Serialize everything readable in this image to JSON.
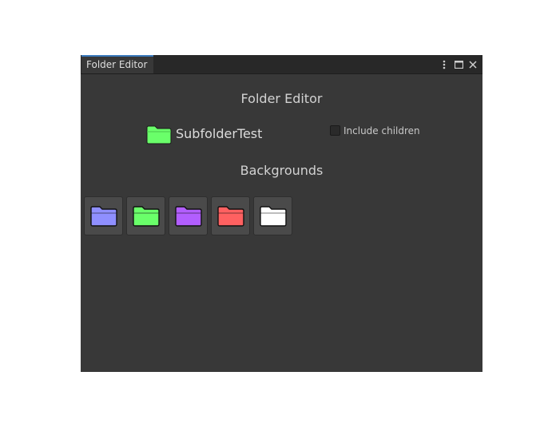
{
  "window": {
    "tab_title": "Folder Editor",
    "controls": [
      "more-options-icon",
      "maximize-icon",
      "close-icon"
    ]
  },
  "editor": {
    "title": "Folder Editor",
    "current_folder": {
      "name": "SubfolderTest",
      "color": "#6aff6a"
    },
    "include_children": {
      "label": "Include children",
      "checked": false
    },
    "backgrounds_title": "Backgrounds",
    "backgrounds": [
      {
        "name": "folder-blue-icon",
        "color": "#8f8fff"
      },
      {
        "name": "folder-green-icon",
        "color": "#6aff6a"
      },
      {
        "name": "folder-purple-icon",
        "color": "#b25eff"
      },
      {
        "name": "folder-red-icon",
        "color": "#ff6161"
      },
      {
        "name": "folder-white-icon",
        "color": "#ffffff"
      }
    ]
  }
}
